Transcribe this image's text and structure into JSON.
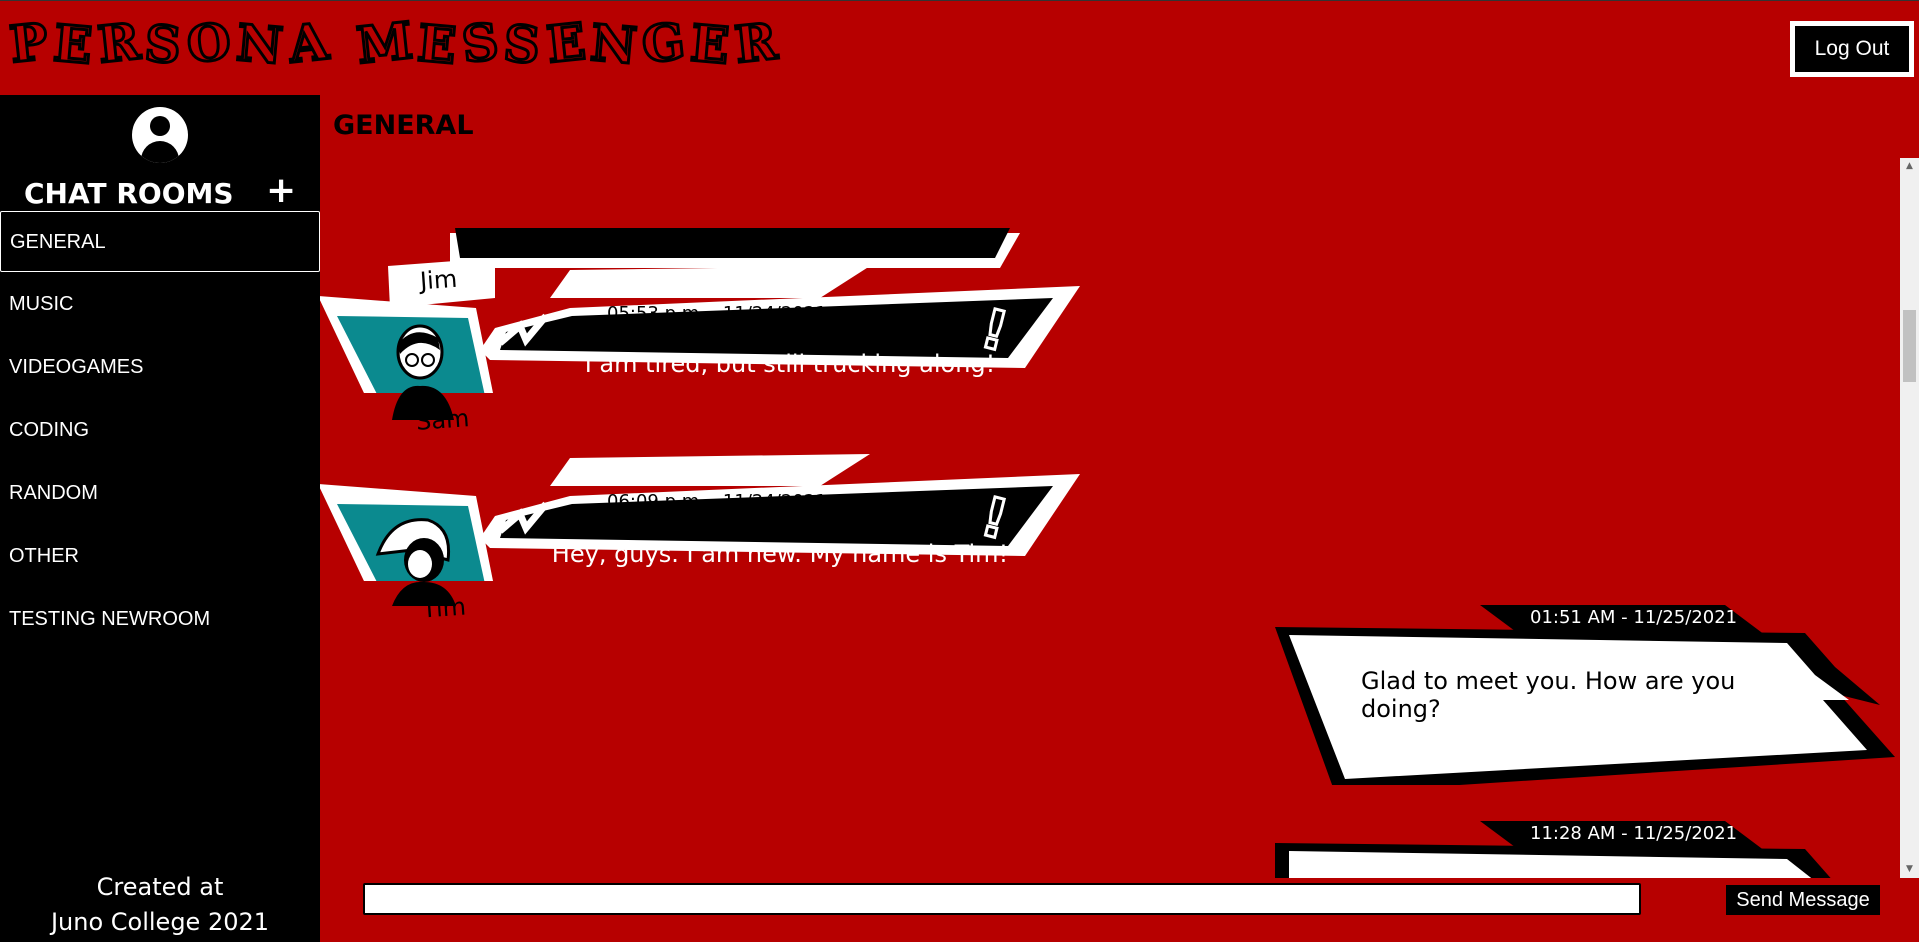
{
  "app": {
    "title": "PERSONA MESSENGER",
    "logout_label": "Log Out"
  },
  "sidebar": {
    "rooms_title": "CHAT ROOMS",
    "add_label": "+",
    "rooms": [
      {
        "label": "GENERAL",
        "active": true
      },
      {
        "label": "MUSIC",
        "active": false
      },
      {
        "label": "VIDEOGAMES",
        "active": false
      },
      {
        "label": "CODING",
        "active": false
      },
      {
        "label": "RANDOM",
        "active": false
      },
      {
        "label": "OTHER",
        "active": false
      },
      {
        "label": "TESTING NEWROOM",
        "active": false
      }
    ],
    "credits_line1": "Created at",
    "credits_line2": "Juno College 2021"
  },
  "main": {
    "room_title": "GENERAL",
    "messages": [
      {
        "author": "Jim",
        "time": "",
        "text": "",
        "self": false
      },
      {
        "author": "Sam",
        "time": "05:53 p.m. - 11/24/2021",
        "text": "I am tired, but still trucking along!",
        "self": false
      },
      {
        "author": "Tim",
        "time": "06:09 p.m. - 11/24/2021",
        "text": "Hey, guys. I am new. My name is Tim!",
        "self": false
      },
      {
        "author": "",
        "time": "01:51 AM - 11/25/2021",
        "text": "Glad to meet you. How are you doing?",
        "self": true
      },
      {
        "author": "",
        "time": "11:28 AM - 11/25/2021",
        "text": "",
        "self": true
      }
    ]
  },
  "composer": {
    "input_value": "",
    "send_label": "Send Message"
  },
  "colors": {
    "background": "#b70000",
    "sidebar": "#000000",
    "avatar_teal": "#0b8a8f"
  }
}
